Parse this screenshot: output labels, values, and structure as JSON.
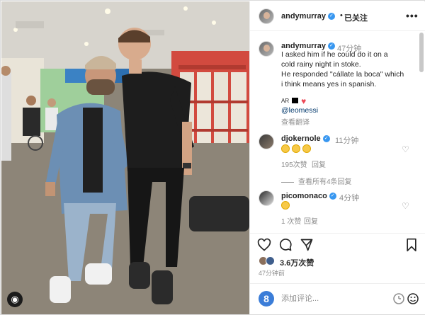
{
  "header": {
    "username": "andymurray",
    "dot": "•",
    "follow_status": "已关注",
    "more_icon": "more-horizontal-icon"
  },
  "caption": {
    "username": "andymurray",
    "time": "47分钟",
    "lines": [
      "I asked him if he could do it on a",
      "cold rainy night in stoke.",
      "He responded \"cállate la boca\" which",
      "i think means yes in spanish."
    ],
    "flags_label": "AR",
    "mention": "@leomessi",
    "translate_label": "查看翻译"
  },
  "comments": [
    {
      "username": "djokernole",
      "time": "11分钟",
      "emoji_count": 3,
      "likes": "195次赞",
      "reply_label": "回复"
    },
    {
      "username": "picomonaco",
      "time": "4分钟",
      "emoji_count": 1,
      "likes": "1 次赞",
      "reply_label": "回复"
    }
  ],
  "view_all_replies": "查看所有4条回复",
  "actions": {
    "like_icon": "heart-icon",
    "comment_icon": "comment-icon",
    "share_icon": "send-icon",
    "save_icon": "bookmark-icon"
  },
  "post": {
    "like_count": "3.6万次赞",
    "time_ago": "47分钟前"
  },
  "add_comment": {
    "placeholder": "添加评论...",
    "emoji_icon": "smiley-icon"
  },
  "colors": {
    "verified": "#3897f0",
    "link": "#00376b",
    "muted": "#8e8e8e",
    "text": "#262626"
  }
}
